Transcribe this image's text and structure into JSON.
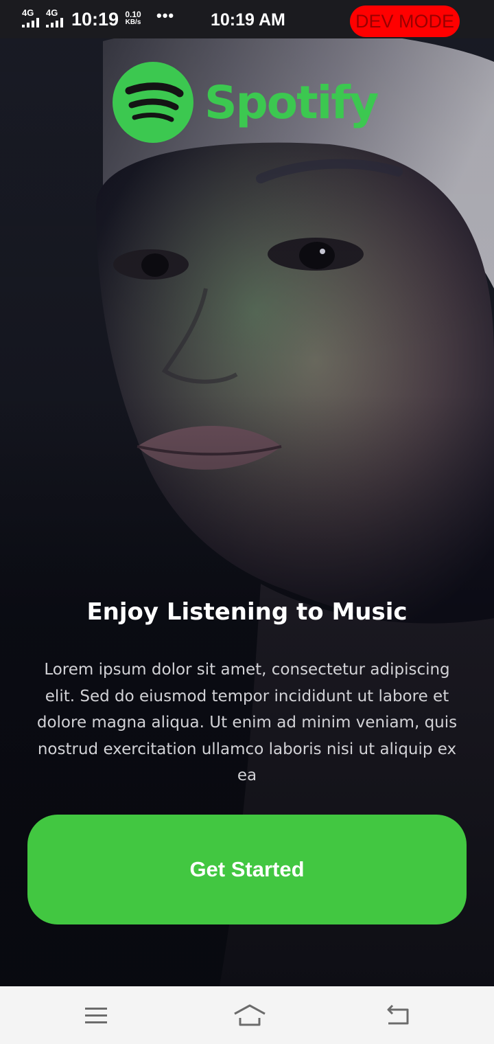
{
  "status_bar": {
    "signal_1": "4G",
    "signal_2": "4G",
    "time_small": "10:19",
    "speed_value": "0.10",
    "speed_unit": "KB/s",
    "more": "•••",
    "time": "10:19 AM",
    "dev_badge": "DEV MODE"
  },
  "logo": {
    "wordmark": "Spotify",
    "registered": "®",
    "icon": "spotify-logo-icon",
    "color": "#3cc850"
  },
  "main": {
    "headline": "Enjoy Listening to Music",
    "body": "Lorem ipsum dolor sit amet, consectetur adipiscing elit. Sed do eiusmod tempor incididunt ut labore et dolore magna aliqua. Ut enim ad minim veniam, quis nostrud exercitation ullamco laboris nisi ut aliquip ex ea",
    "cta_label": "Get Started",
    "cta_color": "#42c741"
  },
  "nav_bar": {
    "menu_icon": "menu-icon",
    "home_icon": "home-icon",
    "back_icon": "back-icon"
  }
}
